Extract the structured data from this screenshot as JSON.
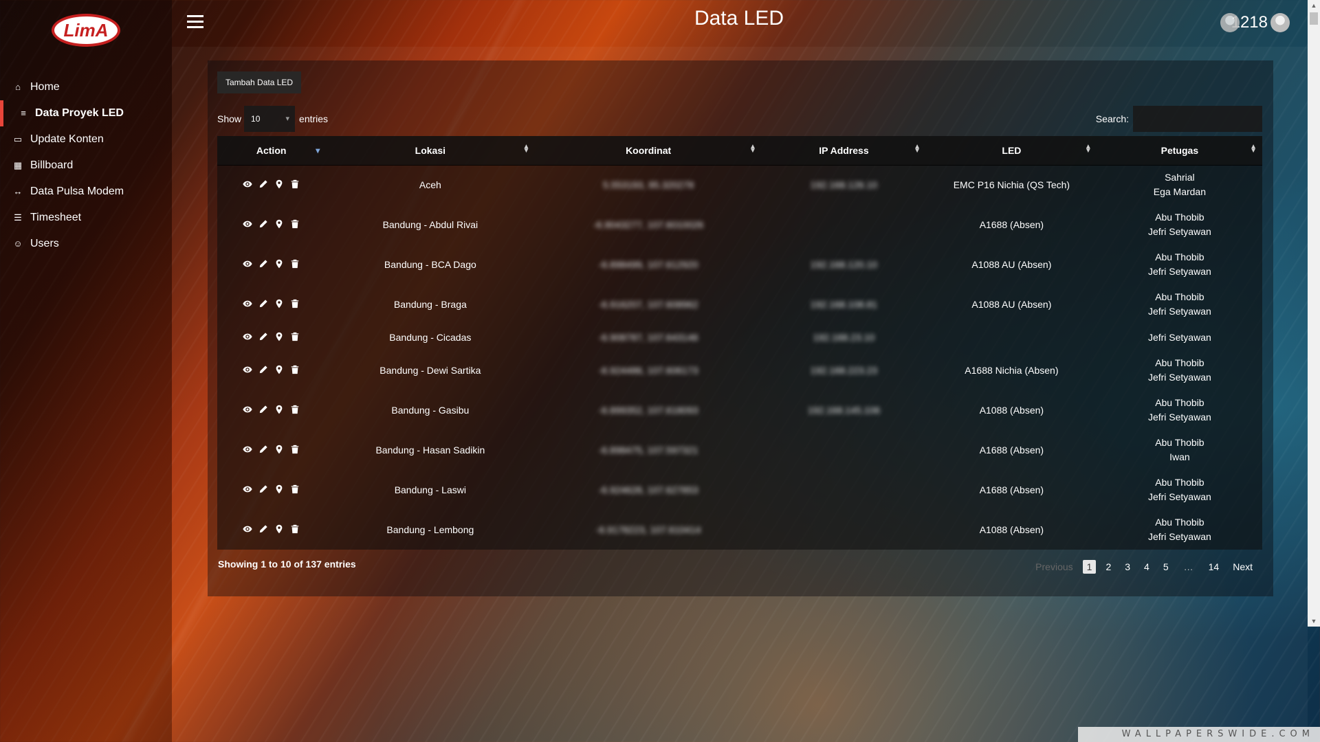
{
  "app": {
    "logo_text": "LimA",
    "page_title": "Data LED",
    "user_id": "1218"
  },
  "sidebar": {
    "items": [
      {
        "label": "Home",
        "icon": "home-icon",
        "glyph": "⌂",
        "active": false
      },
      {
        "label": "Data Proyek LED",
        "icon": "database-icon",
        "glyph": "≡",
        "active": true
      },
      {
        "label": "Update Konten",
        "icon": "monitor-icon",
        "glyph": "▭",
        "active": false
      },
      {
        "label": "Billboard",
        "icon": "grid-icon",
        "glyph": "▦",
        "active": false
      },
      {
        "label": "Data Pulsa Modem",
        "icon": "share-icon",
        "glyph": "↔",
        "active": false
      },
      {
        "label": "Timesheet",
        "icon": "list-icon",
        "glyph": "☰",
        "active": false
      },
      {
        "label": "Users",
        "icon": "users-icon",
        "glyph": "☺",
        "active": false
      }
    ]
  },
  "toolbar": {
    "add_label": "Tambah Data LED",
    "show_label": "Show",
    "entries_label": "entries",
    "page_length": "10",
    "search_label": "Search:",
    "search_value": ""
  },
  "table": {
    "columns": [
      "Action",
      "Lokasi",
      "Koordinat",
      "IP Address",
      "LED",
      "Petugas"
    ],
    "rows": [
      {
        "lokasi": "Aceh",
        "koordinat": "5.553193, 95.320278",
        "ip": "192.168.126.10",
        "led": "EMC P16 Nichia (QS Tech)",
        "petugas": [
          "Sahrial",
          "Ega Mardan"
        ]
      },
      {
        "lokasi": "Bandung - Abdul Rivai",
        "koordinat": "-6.9043277, 107.6010026",
        "ip": "",
        "led": "A1688 (Absen)",
        "petugas": [
          "Abu Thobib",
          "Jefri Setyawan"
        ]
      },
      {
        "lokasi": "Bandung - BCA Dago",
        "koordinat": "-6.898499, 107.612920",
        "ip": "192.168.120.10",
        "led": "A1088 AU (Absen)",
        "petugas": [
          "Abu Thobib",
          "Jefri Setyawan"
        ]
      },
      {
        "lokasi": "Bandung - Braga",
        "koordinat": "-6.916207, 107.608962",
        "ip": "192.168.108.81",
        "led": "A1088 AU (Absen)",
        "petugas": [
          "Abu Thobib",
          "Jefri Setyawan"
        ]
      },
      {
        "lokasi": "Bandung - Cicadas",
        "koordinat": "-6.908787, 107.643146",
        "ip": "192.168.23.10",
        "led": "",
        "petugas": [
          "Jefri Setyawan"
        ]
      },
      {
        "lokasi": "Bandung - Dewi Sartika",
        "koordinat": "-6.924486, 107.606173",
        "ip": "192.168.223.23",
        "led": "A1688 Nichia (Absen)",
        "petugas": [
          "Abu Thobib",
          "Jefri Setyawan"
        ]
      },
      {
        "lokasi": "Bandung - Gasibu",
        "koordinat": "-6.899352, 107.618093",
        "ip": "192.168.145.106",
        "led": "A1088 (Absen)",
        "petugas": [
          "Abu Thobib",
          "Jefri Setyawan"
        ]
      },
      {
        "lokasi": "Bandung - Hasan Sadikin",
        "koordinat": "-6.898475, 107.597321",
        "ip": "",
        "led": "A1688 (Absen)",
        "petugas": [
          "Abu Thobib",
          "Iwan"
        ]
      },
      {
        "lokasi": "Bandung - Laswi",
        "koordinat": "-6.924628, 107.627853",
        "ip": "",
        "led": "A1688 (Absen)",
        "petugas": [
          "Abu Thobib",
          "Jefri Setyawan"
        ]
      },
      {
        "lokasi": "Bandung - Lembong",
        "koordinat": "-6.9178223, 107.610414",
        "ip": "",
        "led": "A1088 (Absen)",
        "petugas": [
          "Abu Thobib",
          "Jefri Setyawan"
        ]
      }
    ]
  },
  "footer": {
    "info": "Showing 1 to 10 of 137 entries",
    "previous": "Previous",
    "next": "Next",
    "pages": [
      "1",
      "2",
      "3",
      "4",
      "5"
    ],
    "ellipsis": "…",
    "last_page": "14",
    "current_page": "1"
  },
  "watermark": "WALLPAPERSWIDE.COM",
  "colors": {
    "accent": "#e8453a",
    "logo_red": "#c62020"
  }
}
